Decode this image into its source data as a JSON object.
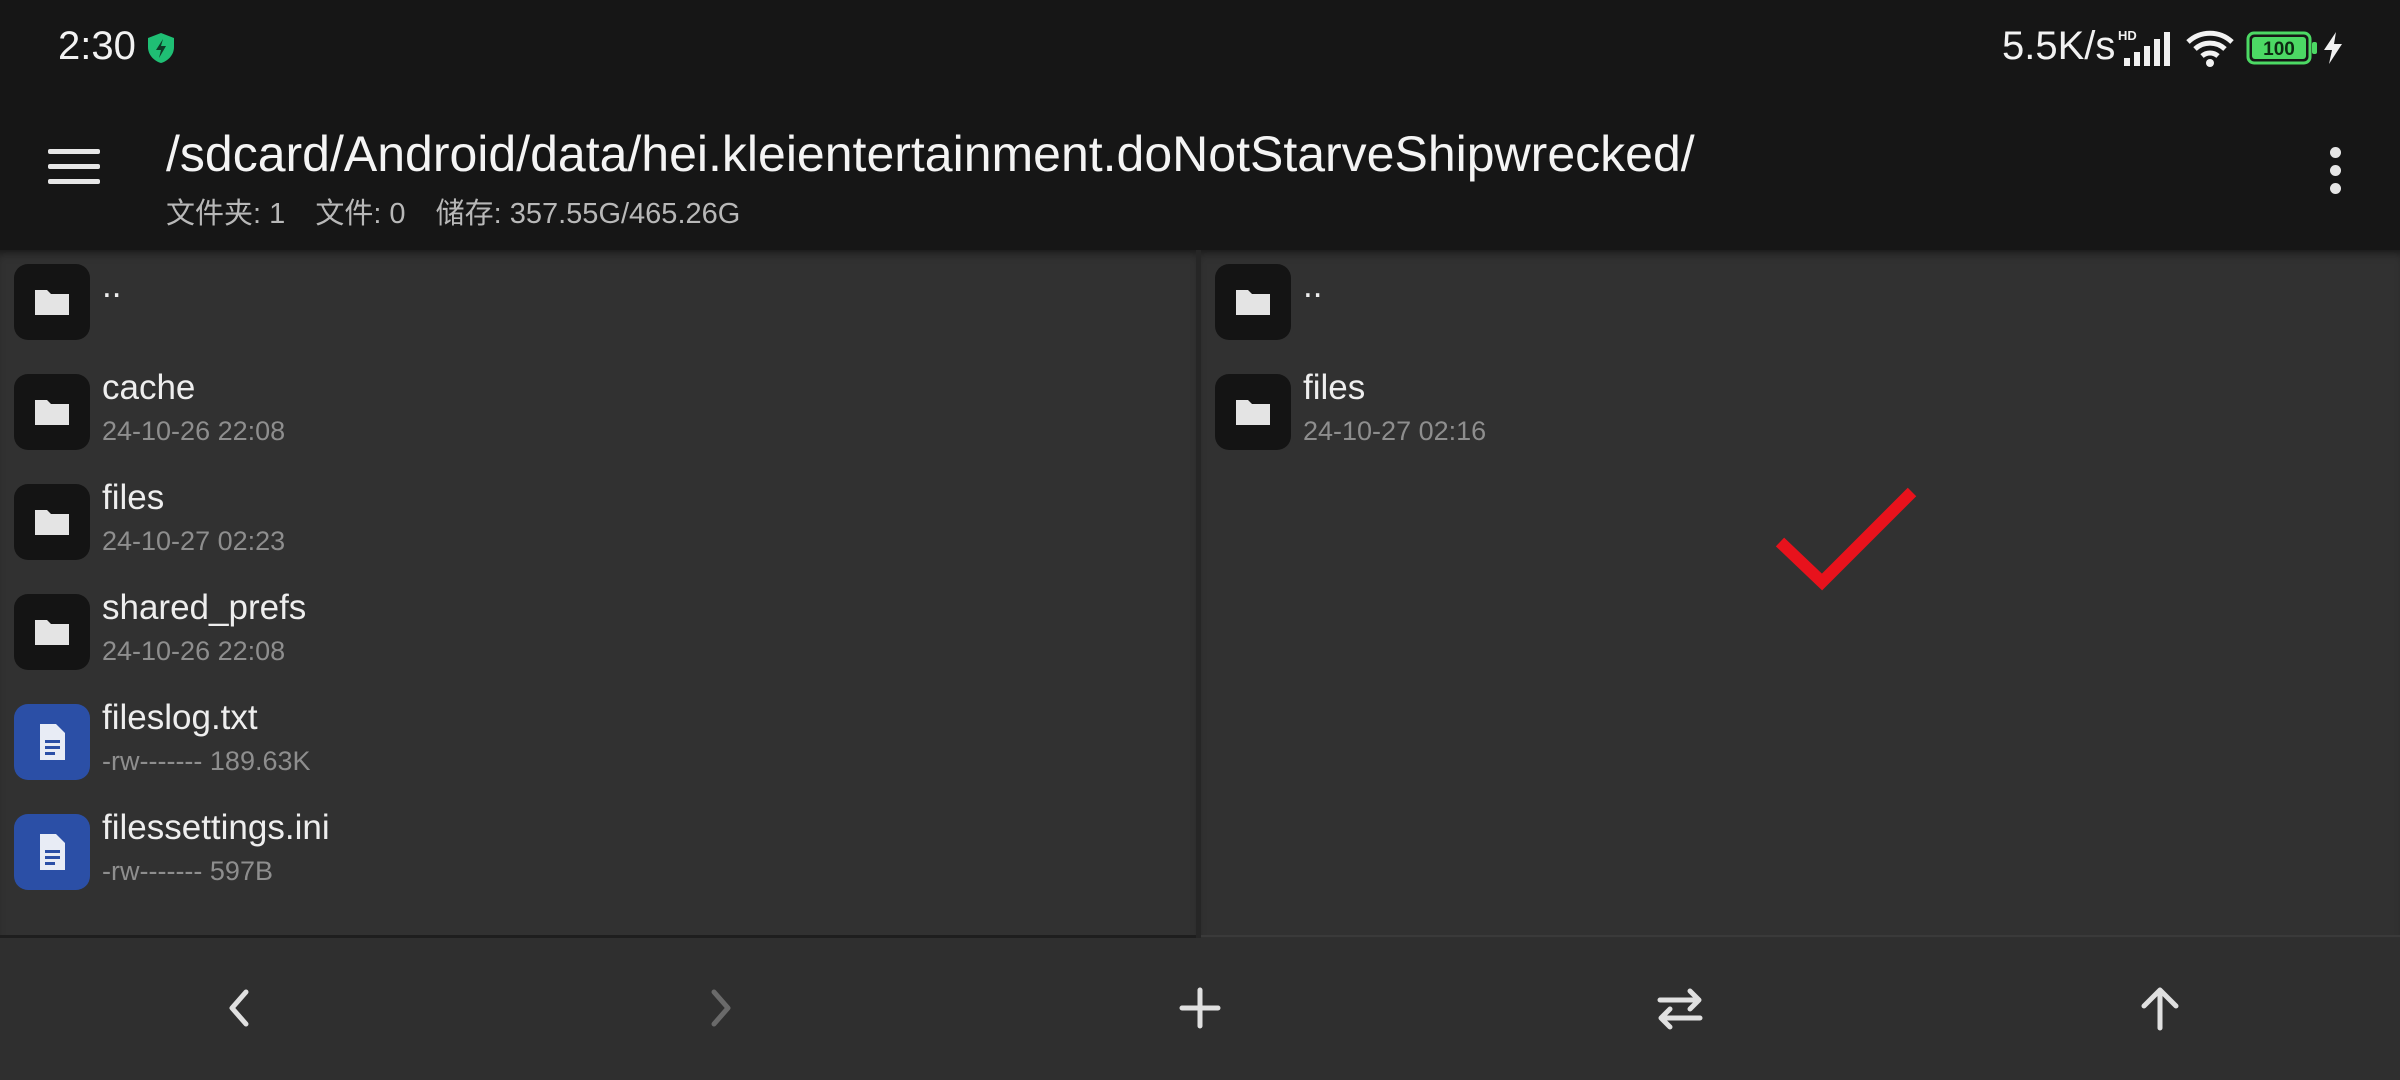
{
  "status_bar": {
    "time": "2:30",
    "net_speed": "5.5K/s",
    "network_badge": "HD",
    "battery_level": "100",
    "icons": [
      "shield-icon",
      "signal-icon",
      "wifi-icon",
      "battery-icon",
      "charging-icon"
    ]
  },
  "toolbar": {
    "path": "/sdcard/Android/data/hei.kleientertainment.doNotStarveShipwrecked/",
    "folders_label": "文件夹: 1",
    "files_label": "文件: 0",
    "storage_label": "储存: 357.55G/465.26G",
    "icons": [
      "menu-icon",
      "more-vert-icon"
    ]
  },
  "left_pane": {
    "items": [
      {
        "name": "..",
        "meta": "",
        "type": "folder"
      },
      {
        "name": "cache",
        "meta": "24-10-26 22:08",
        "type": "folder"
      },
      {
        "name": "files",
        "meta": "24-10-27 02:23",
        "type": "folder"
      },
      {
        "name": "shared_prefs",
        "meta": "24-10-26 22:08",
        "type": "folder"
      },
      {
        "name": "fileslog.txt",
        "meta": "-rw------- 189.63K",
        "type": "file"
      },
      {
        "name": "filessettings.ini",
        "meta": "-rw------- 597B",
        "type": "file"
      }
    ]
  },
  "right_pane": {
    "items": [
      {
        "name": "..",
        "meta": "",
        "type": "folder"
      },
      {
        "name": "files",
        "meta": "24-10-27 02:16",
        "type": "folder"
      }
    ],
    "overlay_icon": "checkmark-icon"
  },
  "bottom_bar": {
    "buttons": [
      "back-icon",
      "forward-icon",
      "add-icon",
      "swap-icon",
      "up-icon"
    ]
  },
  "colors": {
    "bar_background": "#161616",
    "pane_background": "#313131",
    "folder_icon_bg": "#141414",
    "file_icon_bg": "#2b4fa6",
    "status_shield": "#1fbf74",
    "battery_green": "#4cd964",
    "checkmark": "#e8121c"
  }
}
